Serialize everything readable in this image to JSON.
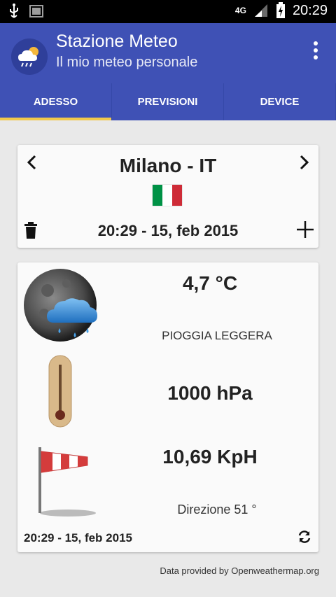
{
  "status_bar": {
    "time": "20:29",
    "network": "4G"
  },
  "app": {
    "title": "Stazione Meteo",
    "subtitle": "Il mio meteo personale"
  },
  "tabs": [
    {
      "label": "ADESSO",
      "active": true
    },
    {
      "label": "PREVISIONI",
      "active": false
    },
    {
      "label": "DEVICE",
      "active": false
    }
  ],
  "location": {
    "city": "Milano - IT",
    "flag_colors": [
      "#009246",
      "#ffffff",
      "#ce2b37"
    ],
    "datetime": "20:29 - 15, feb 2015"
  },
  "weather": {
    "temperature": "4,7 °C",
    "description": "PIOGGIA LEGGERA",
    "pressure": "1000 hPa",
    "wind_speed": "10,69 KpH",
    "wind_direction": "Direzione 51 °",
    "updated": "20:29 - 15, feb 2015"
  },
  "footer": {
    "credit": "Data provided by Openweathermap.org"
  },
  "colors": {
    "primary": "#3f51b5",
    "tab_indicator": "#f2c94c"
  }
}
